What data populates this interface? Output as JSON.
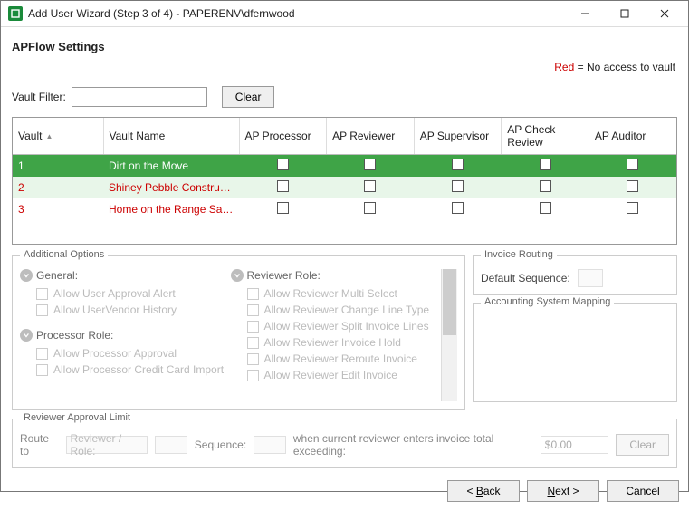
{
  "window": {
    "title": "Add User Wizard (Step 3 of 4) - PAPERENV\\dfernwood"
  },
  "page": {
    "heading": "APFlow Settings",
    "legend_red": "Red",
    "legend_rest": " = No access to vault"
  },
  "filter": {
    "label": "Vault Filter:",
    "value": "",
    "clear": "Clear"
  },
  "grid": {
    "cols": {
      "vault": "Vault",
      "vault_name": "Vault Name",
      "ap_processor": "AP Processor",
      "ap_reviewer": "AP Reviewer",
      "ap_supervisor": "AP Supervisor",
      "ap_check_review": "AP Check Review",
      "ap_auditor": "AP Auditor"
    },
    "rows": [
      {
        "id": "1",
        "name": "Dirt on the Move",
        "no_access": false,
        "selected": true
      },
      {
        "id": "2",
        "name": "Shiney Pebble Constru…",
        "no_access": true,
        "selected": false,
        "alt": true
      },
      {
        "id": "3",
        "name": "Home on the Range Sa…",
        "no_access": true,
        "selected": false
      }
    ]
  },
  "additional": {
    "label": "Additional Options",
    "general": {
      "title": "General:",
      "opts": [
        "Allow User Approval Alert",
        "Allow UserVendor History"
      ]
    },
    "processor": {
      "title": "Processor Role:",
      "opts": [
        "Allow Processor Approval",
        "Allow Processor Credit Card Import"
      ]
    },
    "reviewer": {
      "title": "Reviewer Role:",
      "opts": [
        "Allow Reviewer Multi Select",
        "Allow Reviewer Change Line Type",
        "Allow Reviewer Split Invoice Lines",
        "Allow Reviewer Invoice Hold",
        "Allow Reviewer Reroute Invoice",
        "Allow Reviewer Edit Invoice"
      ]
    }
  },
  "routing": {
    "label": "Invoice Routing",
    "seq_label": "Default Sequence:"
  },
  "mapping": {
    "label": "Accounting System Mapping"
  },
  "limit": {
    "label": "Reviewer Approval Limit",
    "route_to": "Route to",
    "reviewer_role_ph": "Reviewer / Role:",
    "sequence": "Sequence:",
    "tail": "when current reviewer enters invoice total exceeding:",
    "amount": "$0.00",
    "clear": "Clear"
  },
  "footer": {
    "back": "Back",
    "next": "Next",
    "cancel": "Cancel"
  }
}
